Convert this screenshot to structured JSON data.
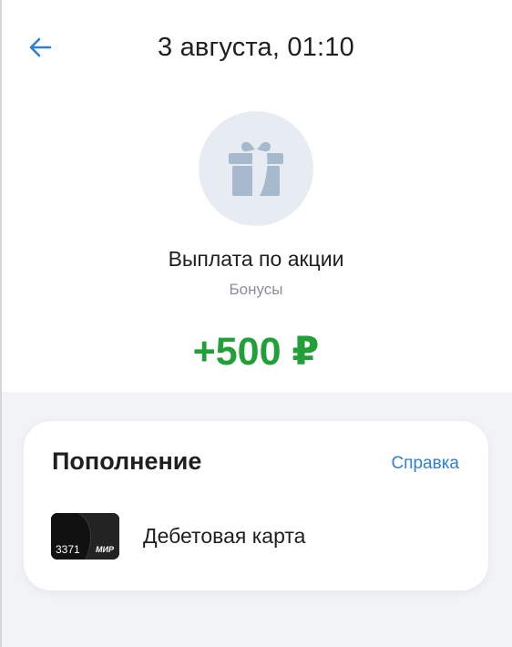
{
  "header": {
    "title": "3 августа, 01:10",
    "back_icon": "arrow-left-icon"
  },
  "transaction": {
    "icon": "gift-icon",
    "title": "Выплата по акции",
    "category": "Бонусы",
    "amount": "+500 ₽"
  },
  "details": {
    "section_title": "Пополнение",
    "help_link": "Справка",
    "account": {
      "card_last_digits": "3371",
      "payment_system": "МИР",
      "name": "Дебетовая карта"
    }
  },
  "colors": {
    "accent_blue": "#2f7fd4",
    "amount_green": "#21a038",
    "gift_bg": "#e7ecf2",
    "gift_icon": "#a7b9cc",
    "text_primary": "#1f1f1f",
    "text_secondary": "#8a8f99"
  }
}
